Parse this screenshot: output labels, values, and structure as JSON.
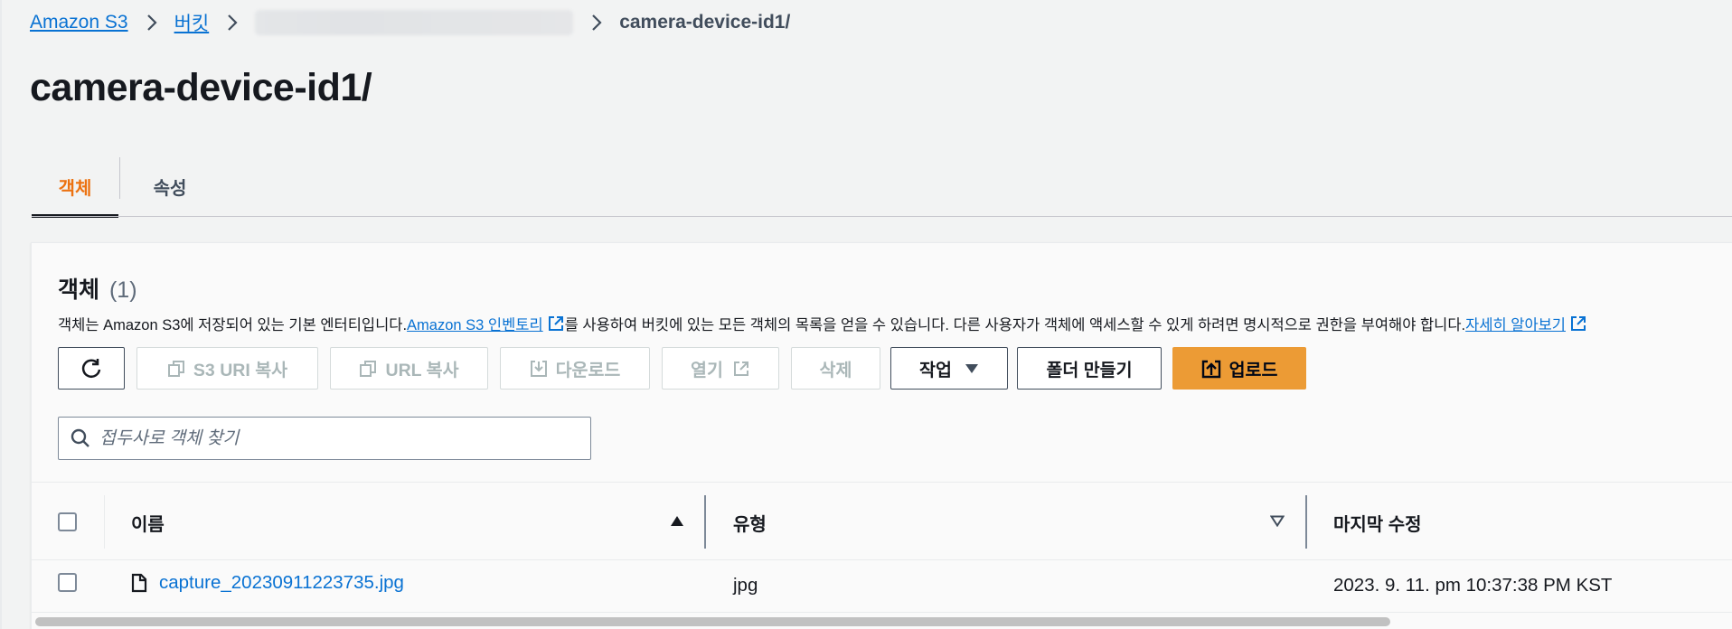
{
  "breadcrumb": {
    "items": [
      {
        "label": "Amazon S3"
      },
      {
        "label": "버킷"
      }
    ],
    "current": "camera-device-id1/"
  },
  "page": {
    "title": "camera-device-id1/"
  },
  "tabs": [
    {
      "label": "객체",
      "active": true
    },
    {
      "label": "속성",
      "active": false
    }
  ],
  "panel": {
    "title": "객체",
    "count": "(1)",
    "description_before": "객체는 Amazon S3에 저장되어 있는 기본 엔터티입니다. ",
    "inventory_link": "Amazon S3 인벤토리",
    "description_after": "를 사용하여 버킷에 있는 모든 객체의 목록을 얻을 수 있습니다. 다른 사용자가 객체에 액세스할 수 있게 하려면 명시적으로 권한을 부여해야 합니다. ",
    "learn_more_link": "자세히 알아보기"
  },
  "toolbar": {
    "copy_s3_uri": "S3 URI 복사",
    "copy_url": "URL 복사",
    "download": "다운로드",
    "open": "열기",
    "delete": "삭제",
    "actions": "작업",
    "create_folder": "폴더 만들기",
    "upload": "업로드"
  },
  "search": {
    "placeholder": "접두사로 객체 찾기",
    "value": ""
  },
  "table": {
    "columns": [
      {
        "label": "이름",
        "sort": "ascending"
      },
      {
        "label": "유형",
        "sort": "none"
      },
      {
        "label": "마지막 수정"
      }
    ],
    "rows": [
      {
        "name": "capture_20230911223735.jpg",
        "type": "jpg",
        "last_modified": "2023. 9. 11. pm 10:37:38 PM KST"
      }
    ]
  },
  "colors": {
    "accent_orange": "#ec7211",
    "upload_button": "#ec9b35",
    "link_blue": "#0972d3",
    "page_bg": "#f2f3f3"
  },
  "icons": {
    "refresh": "refresh-icon",
    "copy": "copy-icon",
    "download": "download-icon",
    "external": "external-link-icon",
    "caret": "caret-down-icon",
    "upload": "upload-icon",
    "search": "search-icon",
    "file": "file-icon"
  }
}
